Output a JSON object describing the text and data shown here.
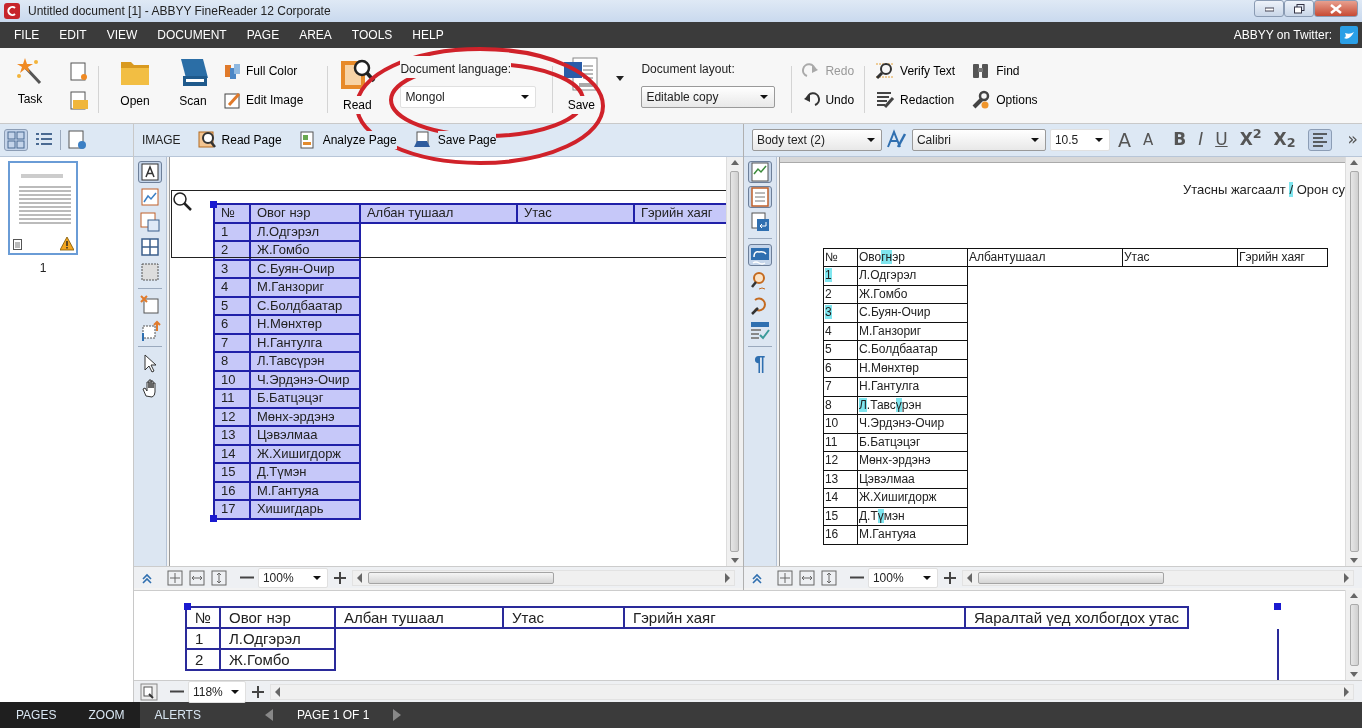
{
  "window": {
    "title": "Untitled document [1] - ABBYY FineReader 12 Corporate"
  },
  "menu": [
    {
      "label": "FILE"
    },
    {
      "label": "EDIT"
    },
    {
      "label": "VIEW"
    },
    {
      "label": "DOCUMENT"
    },
    {
      "label": "PAGE"
    },
    {
      "label": "AREA"
    },
    {
      "label": "TOOLS"
    },
    {
      "label": "HELP"
    }
  ],
  "twitter": {
    "label": "ABBYY on Twitter:"
  },
  "ribbon": {
    "task": {
      "label": "Task"
    },
    "open": {
      "label": "Open"
    },
    "scan": {
      "label": "Scan"
    },
    "image_buttons": [
      {
        "label": "Full Color"
      },
      {
        "label": "Edit Image"
      }
    ],
    "read": {
      "label": "Read"
    },
    "language": {
      "label": "Document language:",
      "value": "Mongol"
    },
    "save": {
      "label": "Save"
    },
    "layout": {
      "label": "Document layout:",
      "value": "Editable copy"
    },
    "history": [
      {
        "label": "Redo",
        "disabled": true
      },
      {
        "label": "Undo",
        "disabled": false
      }
    ],
    "tools": [
      {
        "label": "Verify Text"
      },
      {
        "label": "Redaction"
      },
      {
        "label": "Find"
      },
      {
        "label": "Options"
      }
    ]
  },
  "pages_pane": {
    "views": [
      {
        "selected": true
      },
      {
        "selected": false
      }
    ],
    "pages": [
      {
        "number": "1",
        "selected": true,
        "warning": true
      }
    ]
  },
  "image_pane": {
    "title": "IMAGE",
    "actions": [
      {
        "label": "Read Page"
      },
      {
        "label": "Analyze Page"
      },
      {
        "label": "Save Page"
      }
    ],
    "tools": [
      {
        "selected": true
      },
      {
        "selected": false
      },
      {
        "selected": false
      },
      {
        "selected": false
      },
      {
        "selected": false
      },
      {
        "selected": false
      },
      {
        "selected": false
      },
      {
        "selected": false
      },
      {
        "selected": false
      }
    ],
    "table": {
      "columns": [
        "№",
        "Овог нэр",
        "Албан тушаал",
        "Утас",
        "Гэрийн хаяг"
      ],
      "rows": [
        [
          "1",
          "Л.Одгэрэл"
        ],
        [
          "2",
          "Ж.Гомбо"
        ],
        [
          "3",
          "С.Буян-Очир"
        ],
        [
          "4",
          "М.Ганзориг"
        ],
        [
          "5",
          "С.Болдбаатар"
        ],
        [
          "6",
          "Н.Мөнхтөр"
        ],
        [
          "7",
          "Н.Гантулга"
        ],
        [
          "8",
          "Л.Тавсүрэн"
        ],
        [
          "10",
          "Ч.Эрдэнэ-Очир"
        ],
        [
          "11",
          "Б.Батцэцэг"
        ],
        [
          "12",
          "Мөнх-эрдэнэ"
        ],
        [
          "13",
          "Цэвэлмаа"
        ],
        [
          "14",
          "Ж.Хишигдорж"
        ],
        [
          "15",
          "Д.Түмэн"
        ],
        [
          "16",
          "М.Гантуяа"
        ],
        [
          "17",
          "Хишигдарь"
        ]
      ]
    },
    "zoom": "100%"
  },
  "text_pane": {
    "style": "Body text (2)",
    "font": "Calibri",
    "size": "10.5",
    "format": [
      {
        "kind": "grow",
        "label": "A"
      },
      {
        "kind": "shrink",
        "label": "A"
      },
      {
        "kind": "bold",
        "label": "B"
      },
      {
        "kind": "italic",
        "label": "I"
      },
      {
        "kind": "underline",
        "label": "U"
      },
      {
        "kind": "superscript",
        "label": "X$^{2}$"
      },
      {
        "kind": "subscript",
        "label": "X$_{2}$"
      }
    ],
    "align_left": {
      "selected": true
    },
    "overflow": "»",
    "tools": [
      {
        "selected": true
      },
      {
        "selected": true
      },
      {
        "selected": false
      },
      {
        "selected": true
      },
      {
        "selected": false
      },
      {
        "selected": false
      },
      {
        "selected": false
      }
    ],
    "pilcrow": "¶",
    "heading": [
      {
        "text": "Утасны жагсаалт ",
        "uncertain": false
      },
      {
        "text": "/",
        "uncertain": true
      },
      {
        "text": " Орон су",
        "uncertain": false
      }
    ],
    "table": {
      "columns": [
        "№",
        [
          {
            "text": "Ово",
            "uncertain": false
          },
          {
            "text": "гн",
            "uncertain": true
          },
          {
            "text": "эр",
            "uncertain": false
          }
        ],
        "Албантушаал",
        "Утас",
        "Гэрийн хаяг"
      ],
      "rows": [
        [
          [
            {
              "text": "1",
              "uncertain": true
            }
          ],
          "Л.Одгэрэл"
        ],
        [
          "2",
          "Ж.Гомбо"
        ],
        [
          [
            {
              "text": "3",
              "uncertain": true
            }
          ],
          "С.Буян-Очир"
        ],
        [
          "4",
          "М.Ганзориг"
        ],
        [
          "5",
          "С.Болдбаатар"
        ],
        [
          "6",
          "Н.Мөнхтөр"
        ],
        [
          "7",
          "Н.Гантулга"
        ],
        [
          "8",
          [
            {
              "text": "Л",
              "uncertain": true
            },
            {
              "text": ".Тавс",
              "uncertain": false
            },
            {
              "text": "ү",
              "uncertain": true
            },
            {
              "text": "рэн",
              "uncertain": false
            }
          ]
        ],
        [
          "10",
          "Ч.Эрдэнэ-Очир"
        ],
        [
          "11",
          "Б.Батцэцэг"
        ],
        [
          "12",
          "Мөнх-эрдэнэ"
        ],
        [
          "13",
          "Цэвэлмаа"
        ],
        [
          "14",
          "Ж.Хишигдорж"
        ],
        [
          "15",
          [
            {
              "text": "Д.Т",
              "uncertain": false
            },
            {
              "text": "ү",
              "uncertain": true
            },
            {
              "text": "мэн",
              "uncertain": false
            }
          ]
        ],
        [
          "16",
          "М.Гантуяа"
        ]
      ]
    },
    "zoom": "100%"
  },
  "zoom_pane": {
    "table": {
      "columns": [
        "№",
        "Овог нэр",
        "Албан тушаал",
        "Утас",
        "Гэрийн хаяг",
        "Яаралтай үед холбогдох утас"
      ],
      "rows": [
        [
          "1",
          "Л.Одгэрэл"
        ],
        [
          "2",
          "Ж.Гомбо"
        ]
      ]
    },
    "zoom": "118%"
  },
  "status_bar": {
    "tabs": [
      {
        "label": "PAGES",
        "selected": true
      },
      {
        "label": "ZOOM",
        "selected": true
      },
      {
        "label": "ALERTS",
        "selected": false
      }
    ],
    "page": "PAGE 1 OF 1"
  }
}
